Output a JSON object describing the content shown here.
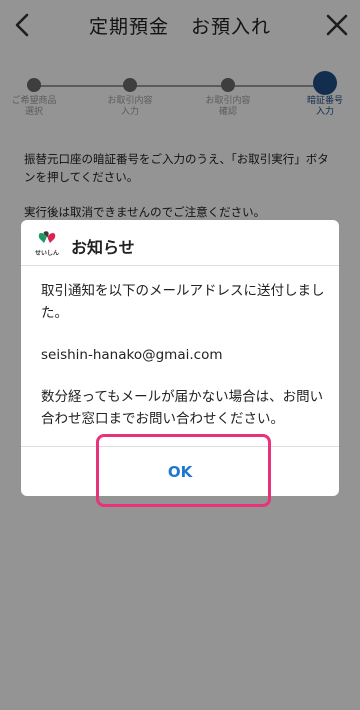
{
  "header": {
    "title_part1": "定期預金",
    "title_part2": "お預入れ",
    "back_icon": "chevron-left-icon",
    "close_icon": "close-icon"
  },
  "stepper": {
    "steps": [
      {
        "label": "ご希望商品\n選択",
        "active": false
      },
      {
        "label": "お取引内容\n入力",
        "active": false
      },
      {
        "label": "お取引内容\n確認",
        "active": false
      },
      {
        "label": "暗証番号\n入力",
        "active": true
      }
    ],
    "current_step": 4,
    "active_color": "#1f4e86"
  },
  "main": {
    "instruction": "振替元口座の暗証番号をご入力のうえ、「お取引実行」ボタンを押してください。",
    "caution": "実行後は取消できませんのでご注意ください。"
  },
  "dialog": {
    "logo_text": "せいしん",
    "title": "お知らせ",
    "message1": "取引通知を以下のメールアドレスに送付しました。",
    "email": "seishin-hanako@gmai.com",
    "message2": "数分経ってもメールが届かない場合は、お問い合わせ窓口までお問い合わせください。",
    "ok_label": "OK",
    "ok_color": "#1e76d2"
  },
  "highlight_color": "#e8337a"
}
